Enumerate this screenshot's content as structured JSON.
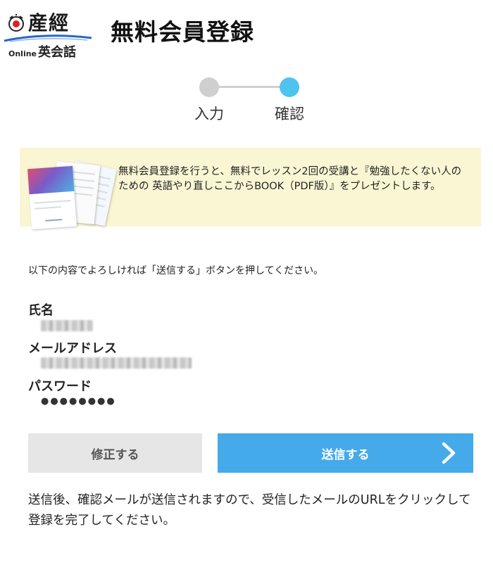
{
  "logo": {
    "brand": "産經",
    "online": "Online",
    "eikaiwa": "英会話",
    "colors": {
      "mark_red": "#d9222a",
      "swoosh_blue": "#2a67c5"
    }
  },
  "page_title": "無料会員登録",
  "steps": [
    {
      "label": "入力",
      "state": "done",
      "color": "#cfcfcf"
    },
    {
      "label": "確認",
      "state": "current",
      "color": "#4fc3ef"
    }
  ],
  "promo": {
    "text": "無料会員登録を行うと、無料でレッスン2回の受講と『勉強したくない人のための 英語やり直しここからBOOK（PDF版）』をプレゼントします。",
    "background": "#faf6d4"
  },
  "instruction": "以下の内容でよろしければ「送信する」ボタンを押してください。",
  "fields": {
    "name_label": "氏名",
    "email_label": "メールアドレス",
    "password_label": "パスワード",
    "password_value": "●●●●●●●●"
  },
  "buttons": {
    "fix_label": "修正する",
    "send_label": "送信する",
    "send_color": "#45aaea",
    "fix_color": "#e6e6e6",
    "send_icon": "chevron-right-icon"
  },
  "note": "送信後、確認メールが送信されますので、受信したメールのURLをクリックして登録を完了してください。"
}
